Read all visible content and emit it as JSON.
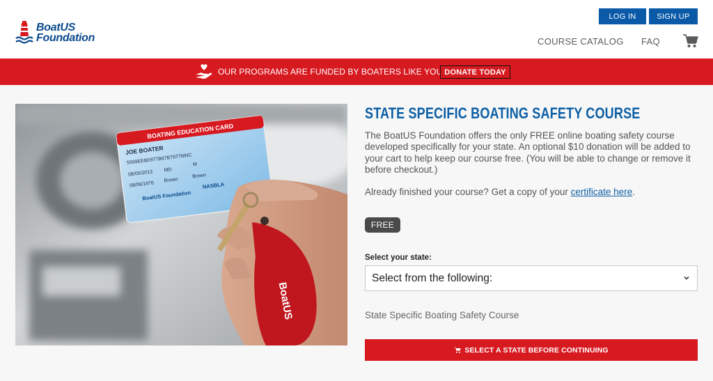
{
  "header": {
    "logo": {
      "line1": "BoatUS",
      "line2": "Foundation"
    },
    "login_label": "LOG IN",
    "signup_label": "SIGN UP",
    "nav": {
      "catalog": "COURSE CATALOG",
      "faq": "FAQ"
    },
    "cart_icon": "shopping-cart-icon"
  },
  "banner": {
    "text": "OUR PROGRAMS ARE FUNDED BY BOATERS LIKE YOU.",
    "donate_label": "DONATE TODAY",
    "icon": "heart-hand-icon"
  },
  "photo": {
    "card_title": "BOATING EDUCATION CARD",
    "card_name": "JOE BOATER",
    "card_number": "5569EE8D977B67B7977MNC",
    "card_date1": "08/05/2013",
    "card_state": "MD",
    "card_sex": "M",
    "card_date2": "08/06/1976",
    "card_eyes": "Brown",
    "card_hair": "Brown",
    "card_logo": "BoatUS Foundation",
    "card_nasbla": "NASBLA",
    "keychain_text": "BoatUS"
  },
  "main": {
    "title": "STATE SPECIFIC BOATING SAFETY COURSE",
    "description": "The BoatUS Foundation offers the only FREE online boating safety course developed specifically for your state. An optional $10 donation will be added to your cart to help keep our course free. (You will be able to change or remove it before checkout.)",
    "finished_text": "Already finished your course? Get a copy of your ",
    "certificate_link": "certificate here",
    "finished_period": ".",
    "price_badge": "FREE",
    "select_label": "Select your state:",
    "select_value": "Select from the following:",
    "course_name": "State Specific Boating Safety Course",
    "cta_label": "SELECT A STATE BEFORE CONTINUING"
  },
  "colors": {
    "brand_blue": "#0a5aa8",
    "banner_red": "#d71920",
    "title_blue": "#0b5fa5"
  }
}
